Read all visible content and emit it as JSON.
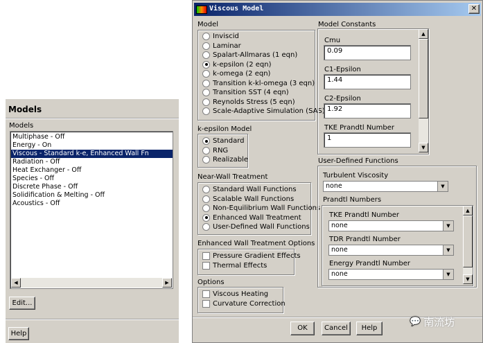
{
  "models_panel": {
    "title": "Models",
    "list_label": "Models",
    "items": [
      "Multiphase - Off",
      "Energy - On",
      "Viscous - Standard k-e, Enhanced Wall Fn",
      "Radiation - Off",
      "Heat Exchanger - Off",
      "Species - Off",
      "Discrete Phase - Off",
      "Solidification & Melting - Off",
      "Acoustics - Off"
    ],
    "selected": 2,
    "edit_label": "Edit...",
    "help_label": "Help"
  },
  "dialog": {
    "title": "Viscous Model",
    "model": {
      "label": "Model",
      "options": [
        "Inviscid",
        "Laminar",
        "Spalart-Allmaras (1 eqn)",
        "k-epsilon (2 eqn)",
        "k-omega (2 eqn)",
        "Transition k-kl-omega (3 eqn)",
        "Transition SST (4 eqn)",
        "Reynolds Stress (5 eqn)",
        "Scale-Adaptive Simulation (SAS)"
      ],
      "selected": 3
    },
    "ke_model": {
      "label": "k-epsilon Model",
      "options": [
        "Standard",
        "RNG",
        "Realizable"
      ],
      "selected": 0
    },
    "near_wall": {
      "label": "Near-Wall Treatment",
      "options": [
        "Standard Wall Functions",
        "Scalable Wall Functions",
        "Non-Equilibrium Wall Functions",
        "Enhanced Wall Treatment",
        "User-Defined Wall Functions"
      ],
      "selected": 3
    },
    "ewt_options": {
      "label": "Enhanced Wall Treatment Options",
      "options": [
        "Pressure Gradient Effects",
        "Thermal Effects"
      ]
    },
    "options": {
      "label": "Options",
      "options": [
        "Viscous Heating",
        "Curvature Correction"
      ]
    },
    "constants": {
      "label": "Model Constants",
      "fields": [
        {
          "label": "Cmu",
          "value": "0.09"
        },
        {
          "label": "C1-Epsilon",
          "value": "1.44"
        },
        {
          "label": "C2-Epsilon",
          "value": "1.92"
        },
        {
          "label": "TKE Prandtl Number",
          "value": "1"
        }
      ]
    },
    "udf": {
      "label": "User-Defined Functions",
      "turb_visc_label": "Turbulent Viscosity",
      "turb_visc_value": "none",
      "prandtl_label": "Prandtl Numbers",
      "prandtl": [
        {
          "label": "TKE Prandtl Number",
          "value": "none"
        },
        {
          "label": "TDR Prandtl Number",
          "value": "none"
        },
        {
          "label": "Energy Prandtl Number",
          "value": "none"
        }
      ]
    },
    "buttons": {
      "ok": "OK",
      "cancel": "Cancel",
      "help": "Help"
    }
  },
  "watermark": "南流坊"
}
